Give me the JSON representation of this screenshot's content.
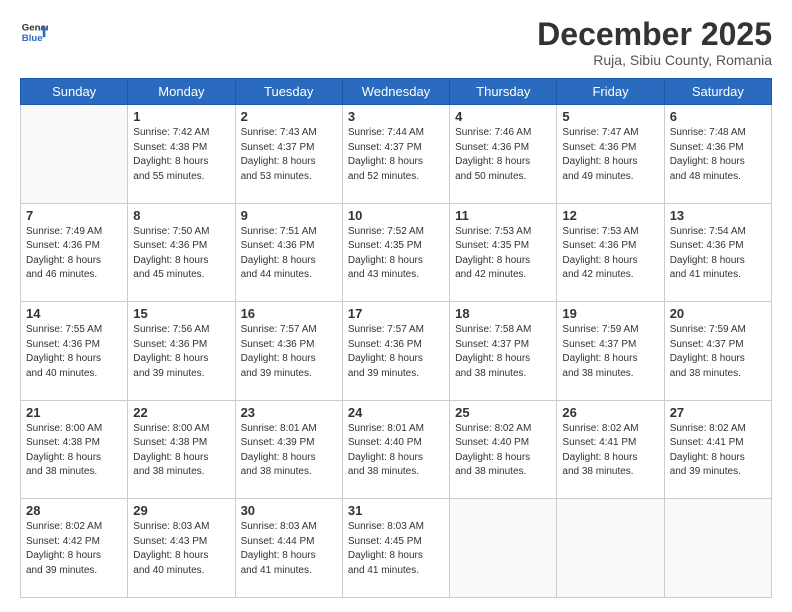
{
  "header": {
    "logo_line1": "General",
    "logo_line2": "Blue",
    "month": "December 2025",
    "location": "Ruja, Sibiu County, Romania"
  },
  "days_of_week": [
    "Sunday",
    "Monday",
    "Tuesday",
    "Wednesday",
    "Thursday",
    "Friday",
    "Saturday"
  ],
  "weeks": [
    [
      {
        "day": "",
        "info": ""
      },
      {
        "day": "1",
        "info": "Sunrise: 7:42 AM\nSunset: 4:38 PM\nDaylight: 8 hours\nand 55 minutes."
      },
      {
        "day": "2",
        "info": "Sunrise: 7:43 AM\nSunset: 4:37 PM\nDaylight: 8 hours\nand 53 minutes."
      },
      {
        "day": "3",
        "info": "Sunrise: 7:44 AM\nSunset: 4:37 PM\nDaylight: 8 hours\nand 52 minutes."
      },
      {
        "day": "4",
        "info": "Sunrise: 7:46 AM\nSunset: 4:36 PM\nDaylight: 8 hours\nand 50 minutes."
      },
      {
        "day": "5",
        "info": "Sunrise: 7:47 AM\nSunset: 4:36 PM\nDaylight: 8 hours\nand 49 minutes."
      },
      {
        "day": "6",
        "info": "Sunrise: 7:48 AM\nSunset: 4:36 PM\nDaylight: 8 hours\nand 48 minutes."
      }
    ],
    [
      {
        "day": "7",
        "info": "Sunrise: 7:49 AM\nSunset: 4:36 PM\nDaylight: 8 hours\nand 46 minutes."
      },
      {
        "day": "8",
        "info": "Sunrise: 7:50 AM\nSunset: 4:36 PM\nDaylight: 8 hours\nand 45 minutes."
      },
      {
        "day": "9",
        "info": "Sunrise: 7:51 AM\nSunset: 4:36 PM\nDaylight: 8 hours\nand 44 minutes."
      },
      {
        "day": "10",
        "info": "Sunrise: 7:52 AM\nSunset: 4:35 PM\nDaylight: 8 hours\nand 43 minutes."
      },
      {
        "day": "11",
        "info": "Sunrise: 7:53 AM\nSunset: 4:35 PM\nDaylight: 8 hours\nand 42 minutes."
      },
      {
        "day": "12",
        "info": "Sunrise: 7:53 AM\nSunset: 4:36 PM\nDaylight: 8 hours\nand 42 minutes."
      },
      {
        "day": "13",
        "info": "Sunrise: 7:54 AM\nSunset: 4:36 PM\nDaylight: 8 hours\nand 41 minutes."
      }
    ],
    [
      {
        "day": "14",
        "info": "Sunrise: 7:55 AM\nSunset: 4:36 PM\nDaylight: 8 hours\nand 40 minutes."
      },
      {
        "day": "15",
        "info": "Sunrise: 7:56 AM\nSunset: 4:36 PM\nDaylight: 8 hours\nand 39 minutes."
      },
      {
        "day": "16",
        "info": "Sunrise: 7:57 AM\nSunset: 4:36 PM\nDaylight: 8 hours\nand 39 minutes."
      },
      {
        "day": "17",
        "info": "Sunrise: 7:57 AM\nSunset: 4:36 PM\nDaylight: 8 hours\nand 39 minutes."
      },
      {
        "day": "18",
        "info": "Sunrise: 7:58 AM\nSunset: 4:37 PM\nDaylight: 8 hours\nand 38 minutes."
      },
      {
        "day": "19",
        "info": "Sunrise: 7:59 AM\nSunset: 4:37 PM\nDaylight: 8 hours\nand 38 minutes."
      },
      {
        "day": "20",
        "info": "Sunrise: 7:59 AM\nSunset: 4:37 PM\nDaylight: 8 hours\nand 38 minutes."
      }
    ],
    [
      {
        "day": "21",
        "info": "Sunrise: 8:00 AM\nSunset: 4:38 PM\nDaylight: 8 hours\nand 38 minutes."
      },
      {
        "day": "22",
        "info": "Sunrise: 8:00 AM\nSunset: 4:38 PM\nDaylight: 8 hours\nand 38 minutes."
      },
      {
        "day": "23",
        "info": "Sunrise: 8:01 AM\nSunset: 4:39 PM\nDaylight: 8 hours\nand 38 minutes."
      },
      {
        "day": "24",
        "info": "Sunrise: 8:01 AM\nSunset: 4:40 PM\nDaylight: 8 hours\nand 38 minutes."
      },
      {
        "day": "25",
        "info": "Sunrise: 8:02 AM\nSunset: 4:40 PM\nDaylight: 8 hours\nand 38 minutes."
      },
      {
        "day": "26",
        "info": "Sunrise: 8:02 AM\nSunset: 4:41 PM\nDaylight: 8 hours\nand 38 minutes."
      },
      {
        "day": "27",
        "info": "Sunrise: 8:02 AM\nSunset: 4:41 PM\nDaylight: 8 hours\nand 39 minutes."
      }
    ],
    [
      {
        "day": "28",
        "info": "Sunrise: 8:02 AM\nSunset: 4:42 PM\nDaylight: 8 hours\nand 39 minutes."
      },
      {
        "day": "29",
        "info": "Sunrise: 8:03 AM\nSunset: 4:43 PM\nDaylight: 8 hours\nand 40 minutes."
      },
      {
        "day": "30",
        "info": "Sunrise: 8:03 AM\nSunset: 4:44 PM\nDaylight: 8 hours\nand 41 minutes."
      },
      {
        "day": "31",
        "info": "Sunrise: 8:03 AM\nSunset: 4:45 PM\nDaylight: 8 hours\nand 41 minutes."
      },
      {
        "day": "",
        "info": ""
      },
      {
        "day": "",
        "info": ""
      },
      {
        "day": "",
        "info": ""
      }
    ]
  ]
}
